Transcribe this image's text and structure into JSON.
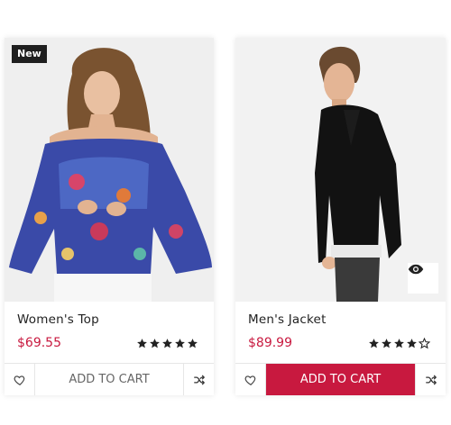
{
  "theme": {
    "accent": "#c8193f",
    "star": "#222222",
    "badge_bg": "#1f1f1f"
  },
  "products": [
    {
      "badge": "New",
      "name": "Women's Top",
      "price": "$69.55",
      "rating": 5,
      "rating_max": 5,
      "cart_label": "ADD TO CART",
      "cart_state": "default",
      "icons": [
        "heart-icon",
        "shuffle-icon"
      ]
    },
    {
      "name": "Men's Jacket",
      "price": "$89.99",
      "rating": 4,
      "rating_max": 5,
      "cart_label": "ADD TO CART",
      "cart_state": "hover",
      "quickview_icon": "eye-icon",
      "icons": [
        "heart-icon",
        "shuffle-icon"
      ]
    }
  ]
}
